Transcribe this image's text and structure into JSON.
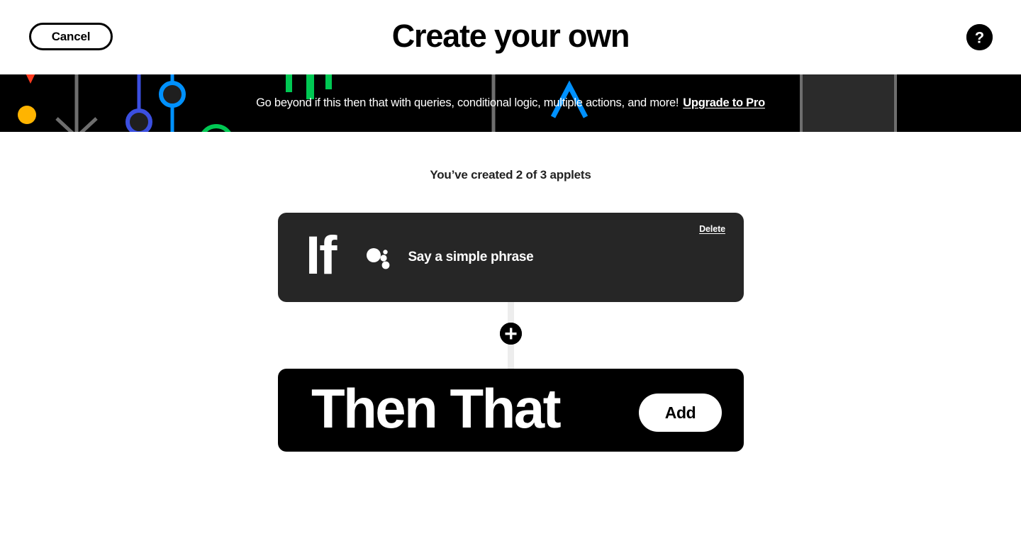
{
  "header": {
    "cancel_label": "Cancel",
    "title": "Create your own",
    "help_icon": "question-mark-circle-icon",
    "help_glyph": "?"
  },
  "banner": {
    "message": "Go beyond if this then that with queries, conditional logic, multiple actions, and more!",
    "upgrade_label": "Upgrade to Pro",
    "background_color": "#000000",
    "text_color": "#ffffff",
    "decor_colors": {
      "red": "#FF3B1F",
      "orange_dot": "#FFB400",
      "orange_x": "#F2620F",
      "gray": "#6E6E6E",
      "blue": "#0091FF",
      "indigo": "#3B4FE0",
      "green": "#00C853",
      "yellow": "#F5B700",
      "panel": "#2B2B2B"
    }
  },
  "main": {
    "applet_count_text": "You’ve created 2 of 3 applets",
    "if_card": {
      "keyword": "If",
      "service_icon": "google-assistant-icon",
      "trigger_title": "Say a simple phrase",
      "delete_label": "Delete",
      "background_color": "#262626"
    },
    "connector": {
      "add_step_icon": "plus-icon",
      "line_color": "#ededed"
    },
    "then_card": {
      "keyword": "Then That",
      "add_label": "Add",
      "background_color": "#000000"
    }
  }
}
